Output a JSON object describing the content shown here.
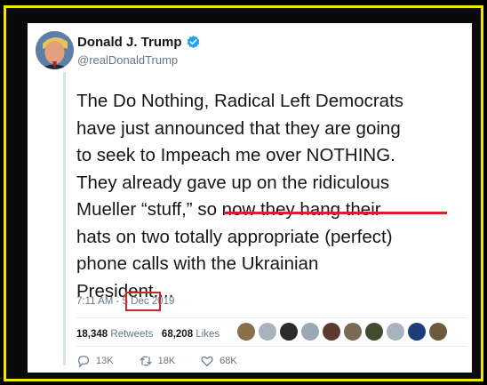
{
  "tweet": {
    "author_name": "Donald J. Trump",
    "handle": "@realDonaldTrump",
    "lines": [
      "The Do Nothing, Radical Left Democrats",
      "have just announced that they are going",
      "to seek to Impeach me over NOTHING.",
      "They already gave up on the ridiculous",
      "Mueller “stuff,” so now they hang their",
      "hats on two totally appropriate (perfect)",
      "phone calls with the Ukrainian",
      "President...."
    ],
    "time": "7:11 AM",
    "date_separator": " - ",
    "date": "5 Dec 2019",
    "retweets_count": "18,348",
    "retweets_label": "Retweets",
    "likes_count": "68,208",
    "likes_label": "Likes",
    "replies": "13K",
    "retweet_action": "18K",
    "likes_action": "68K"
  },
  "colors": {
    "frame_border": "#f2e600",
    "verified": "#1da1f2",
    "highlight": "#d0232a",
    "muted_text": "#657786"
  },
  "likers": [
    {
      "icon": "avatar-icon",
      "color": "#8a6f4a"
    },
    {
      "icon": "avatar-icon",
      "color": "#a7b3bf"
    },
    {
      "icon": "avatar-icon",
      "color": "#2b2b2b"
    },
    {
      "icon": "avatar-icon",
      "color": "#9aa8b6"
    },
    {
      "icon": "avatar-icon",
      "color": "#5c3a2e"
    },
    {
      "icon": "avatar-icon",
      "color": "#7a6a55"
    },
    {
      "icon": "avatar-icon",
      "color": "#3f4d2e"
    },
    {
      "icon": "avatar-icon",
      "color": "#a7b3bf"
    },
    {
      "icon": "avatar-icon",
      "color": "#1c3c7a"
    },
    {
      "icon": "avatar-icon",
      "color": "#6b5a3e"
    }
  ]
}
